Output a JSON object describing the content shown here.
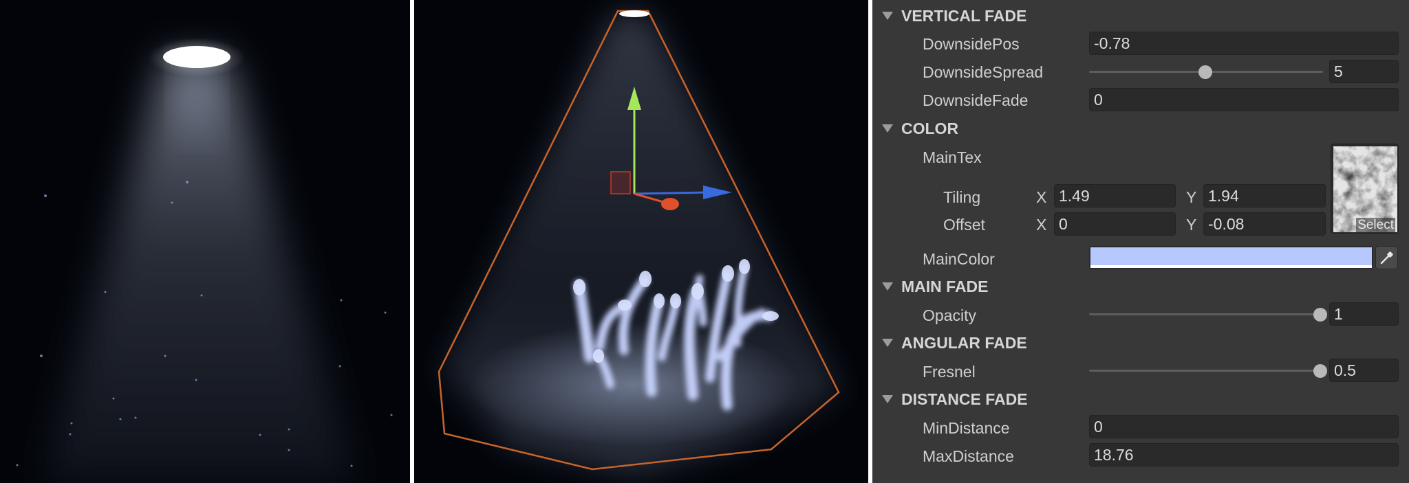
{
  "sections": {
    "vertical_fade": "VERTICAL FADE",
    "color": "COLOR",
    "main_fade": "MAIN FADE",
    "angular_fade": "ANGULAR FADE",
    "distance_fade": "DISTANCE FADE"
  },
  "properties": {
    "downside_pos": {
      "label": "DownsidePos",
      "value": "-0.78"
    },
    "downside_spread": {
      "label": "DownsideSpread",
      "value": "5",
      "slider_fraction": 0.5
    },
    "downside_fade": {
      "label": "DownsideFade",
      "value": "0"
    },
    "main_tex": {
      "label": "MainTex",
      "select_label": "Select"
    },
    "tiling": {
      "label": "Tiling",
      "x_axis": "X",
      "x": "1.49",
      "y_axis": "Y",
      "y": "1.94"
    },
    "offset": {
      "label": "Offset",
      "x_axis": "X",
      "x": "0",
      "y_axis": "Y",
      "y": "-0.08"
    },
    "main_color": {
      "label": "MainColor",
      "color": "#b7c8ff"
    },
    "opacity": {
      "label": "Opacity",
      "value": "1",
      "slider_fraction": 1.0
    },
    "fresnel": {
      "label": "Fresnel",
      "value": "0.5",
      "slider_fraction": 1.0
    },
    "min_distance": {
      "label": "MinDistance",
      "value": "0"
    },
    "max_distance": {
      "label": "MaxDistance",
      "value": "18.76"
    }
  },
  "colors": {
    "inspector_bg": "#383838",
    "field_bg": "#2a2a2a",
    "cone_outline": "#c8642a",
    "gizmo_y": "#a6e65a",
    "gizmo_x": "#e0502a",
    "gizmo_z": "#3a6ae0"
  },
  "icons": [
    "foldout-arrow-icon",
    "eyedropper-icon",
    "move-gizmo-icon"
  ]
}
